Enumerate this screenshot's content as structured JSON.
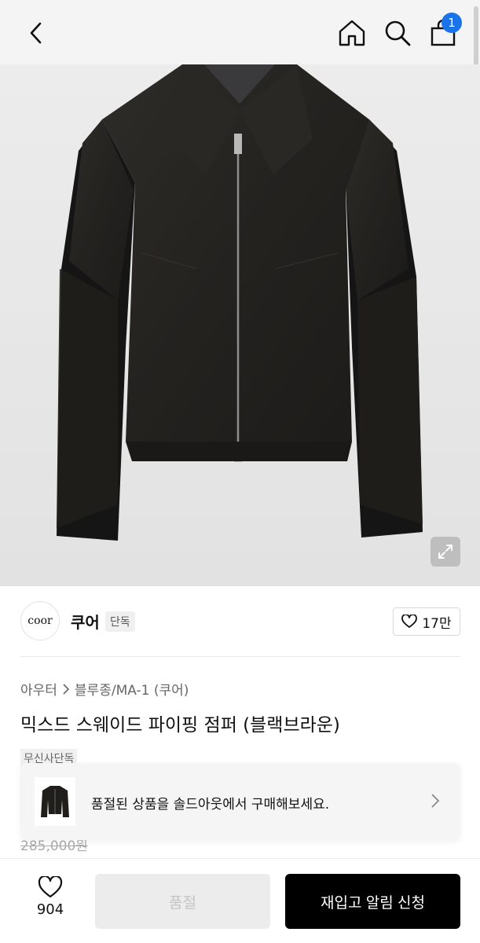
{
  "header": {
    "cart_count": "1"
  },
  "brand": {
    "logo_text": "coor",
    "name": "쿠어",
    "tag": "단독",
    "like_count": "17만"
  },
  "breadcrumb": {
    "category": "아우터",
    "subcategory": "블루종/MA-1 (쿠어)"
  },
  "product": {
    "title": "믹스드 스웨이드 파이핑 점퍼 (블랙브라운)",
    "exclusive_label": "무신사단독",
    "original_price": "285,000원"
  },
  "soldout_banner": {
    "text": "품절된 상품을 솔드아웃에서 구매해보세요."
  },
  "bottom": {
    "wish_count": "904",
    "soldout_label": "품절",
    "restock_label": "재입고 알림 신청"
  },
  "colors": {
    "accent": "#1a73e8",
    "cta": "#000000",
    "disabled": "#ececec"
  }
}
